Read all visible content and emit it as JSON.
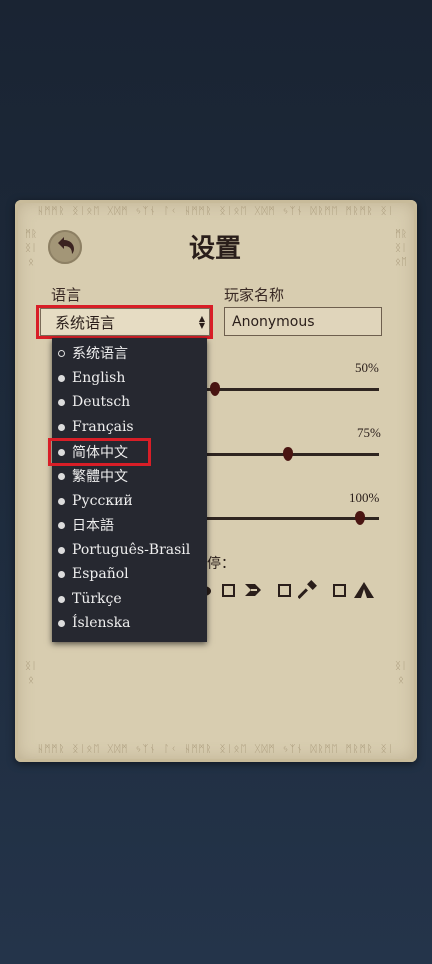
{
  "dialog": {
    "title": "设置",
    "language_label": "语言",
    "player_name_label": "玩家名称",
    "language_selected": "系统语言",
    "player_name_value": "Anonymous",
    "pause_label_partial": "停："
  },
  "sliders": [
    {
      "percent_label": "50%",
      "value": 0.5
    },
    {
      "percent_label": "75%",
      "value": 0.75
    },
    {
      "percent_label": "100%",
      "value": 1.0
    }
  ],
  "language_options": [
    {
      "label": "系统语言",
      "selected": true
    },
    {
      "label": "English"
    },
    {
      "label": "Deutsch"
    },
    {
      "label": "Français"
    },
    {
      "label": "简体中文",
      "highlighted": true
    },
    {
      "label": "繁體中文"
    },
    {
      "label": "Русский"
    },
    {
      "label": "日本語"
    },
    {
      "label": "Português-Brasil"
    },
    {
      "label": "Español"
    },
    {
      "label": "Türkçe"
    },
    {
      "label": "Íslenska"
    }
  ],
  "pause_icons": [
    "fist-icon",
    "arrow-icon",
    "hammer-icon",
    "camp-icon"
  ],
  "colors": {
    "panel": "#d8cdb0",
    "dropdown_bg": "#262830",
    "highlight_red": "#d81e27",
    "slider_thumb": "#4a1512"
  }
}
